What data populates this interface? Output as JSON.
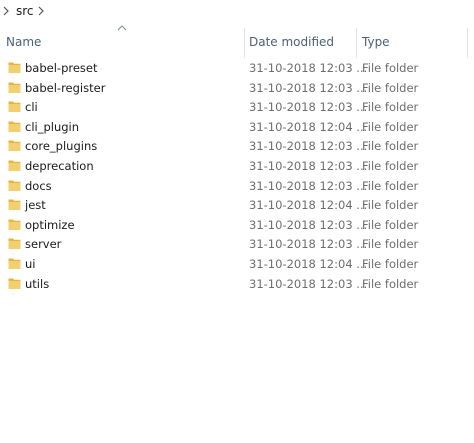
{
  "breadcrumb": {
    "current_folder": "src"
  },
  "columns": {
    "name": "Name",
    "date_modified": "Date modified",
    "type": "Type",
    "sort_icon": "sort-ascending-icon"
  },
  "files": [
    {
      "name": "babel-preset",
      "date": "31-10-2018 12:03 ...",
      "type": "File folder",
      "icon": "folder-icon"
    },
    {
      "name": "babel-register",
      "date": "31-10-2018 12:03 ...",
      "type": "File folder",
      "icon": "folder-icon"
    },
    {
      "name": "cli",
      "date": "31-10-2018 12:03 ...",
      "type": "File folder",
      "icon": "folder-icon"
    },
    {
      "name": "cli_plugin",
      "date": "31-10-2018 12:04 ...",
      "type": "File folder",
      "icon": "folder-icon"
    },
    {
      "name": "core_plugins",
      "date": "31-10-2018 12:03 ...",
      "type": "File folder",
      "icon": "folder-icon"
    },
    {
      "name": "deprecation",
      "date": "31-10-2018 12:03 ...",
      "type": "File folder",
      "icon": "folder-icon"
    },
    {
      "name": "docs",
      "date": "31-10-2018 12:03 ...",
      "type": "File folder",
      "icon": "folder-icon"
    },
    {
      "name": "jest",
      "date": "31-10-2018 12:04 ...",
      "type": "File folder",
      "icon": "folder-icon"
    },
    {
      "name": "optimize",
      "date": "31-10-2018 12:03 ...",
      "type": "File folder",
      "icon": "folder-icon"
    },
    {
      "name": "server",
      "date": "31-10-2018 12:03 ...",
      "type": "File folder",
      "icon": "folder-icon"
    },
    {
      "name": "ui",
      "date": "31-10-2018 12:04 ...",
      "type": "File folder",
      "icon": "folder-icon"
    },
    {
      "name": "utils",
      "date": "31-10-2018 12:03 ...",
      "type": "File folder",
      "icon": "folder-icon"
    }
  ],
  "colors": {
    "header_text": "#4c607a",
    "folder_body": "#e8b53b",
    "folder_tab": "#f3d06f",
    "secondary_text": "#6d6d6d"
  }
}
